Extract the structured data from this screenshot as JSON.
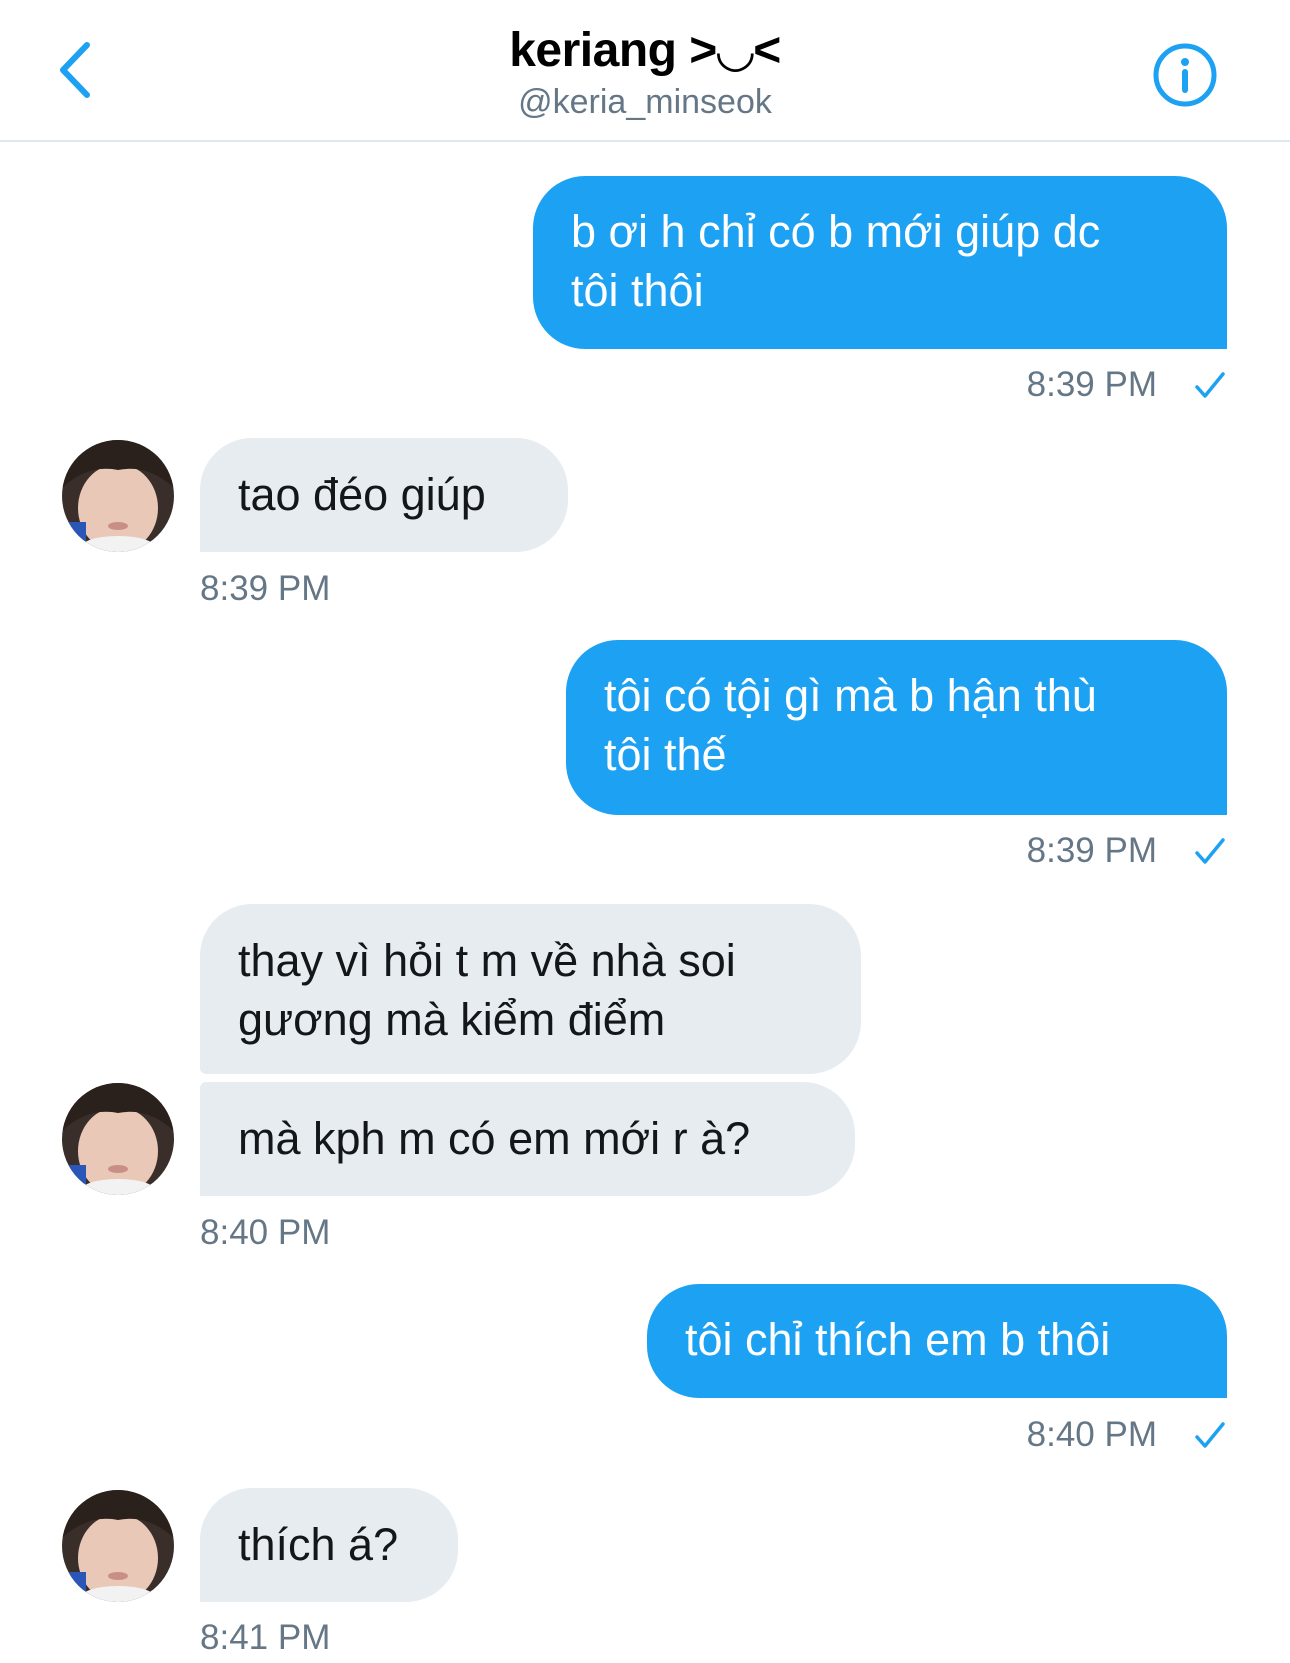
{
  "header": {
    "title": "keriang >◡<",
    "handle": "@keria_minseok"
  },
  "colors": {
    "accent": "#1da1f2",
    "received_bubble": "#e6ecf0",
    "muted_text": "#657786"
  },
  "icons": {
    "back": "chevron-left-icon",
    "info": "info-icon",
    "read": "checkmark-icon"
  },
  "messages": [
    {
      "direction": "sent",
      "lines": [
        "b ơi h chỉ có b mới giúp dc",
        "tôi thôi"
      ],
      "time": "8:39 PM"
    },
    {
      "direction": "received",
      "lines": [
        "tao đéo giúp"
      ],
      "time": "8:39 PM"
    },
    {
      "direction": "sent",
      "lines": [
        "tôi có tội gì mà b hận thù",
        "tôi thế"
      ],
      "time": "8:39 PM"
    },
    {
      "direction": "received",
      "lines": [
        "thay vì hỏi t m về nhà soi",
        "gương mà kiểm điểm"
      ]
    },
    {
      "direction": "received",
      "lines": [
        "mà kph m có em mới r à?"
      ],
      "time": "8:40 PM"
    },
    {
      "direction": "sent",
      "lines": [
        "tôi chỉ thích em b thôi"
      ],
      "time": "8:40 PM"
    },
    {
      "direction": "received",
      "lines": [
        "thích á?"
      ],
      "time": "8:41 PM"
    }
  ]
}
